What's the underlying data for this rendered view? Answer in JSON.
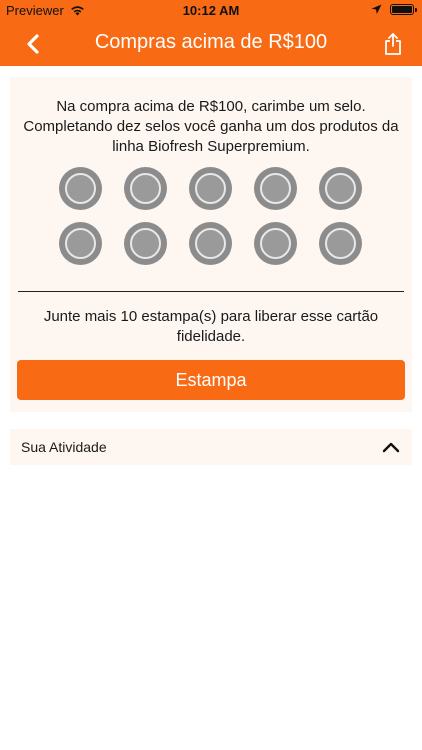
{
  "status_bar": {
    "carrier": "Previewer",
    "time": "10:12 AM",
    "icons": [
      "wifi-icon",
      "location-arrow-icon",
      "battery-icon"
    ]
  },
  "nav": {
    "title": "Compras acima de R$100",
    "back_icon": "chevron-left-icon",
    "share_icon": "share-icon"
  },
  "card": {
    "description": "Na compra acima de R$100, carimbe um selo. Completando dez selos você ganha um dos produtos da linha Biofresh Superpremium.",
    "stamps_total": 10,
    "stamps_collected": 0,
    "remaining_text": "Junte mais  10 estampa(s) para liberar esse cartão fidelidade.",
    "button_label": "Estampa"
  },
  "activity": {
    "label": "Sua Atividade",
    "icon": "chevron-up-icon"
  },
  "colors": {
    "accent": "#f86a14",
    "card_bg": "#fdf6f1",
    "stamp": "#8c8c8c"
  }
}
